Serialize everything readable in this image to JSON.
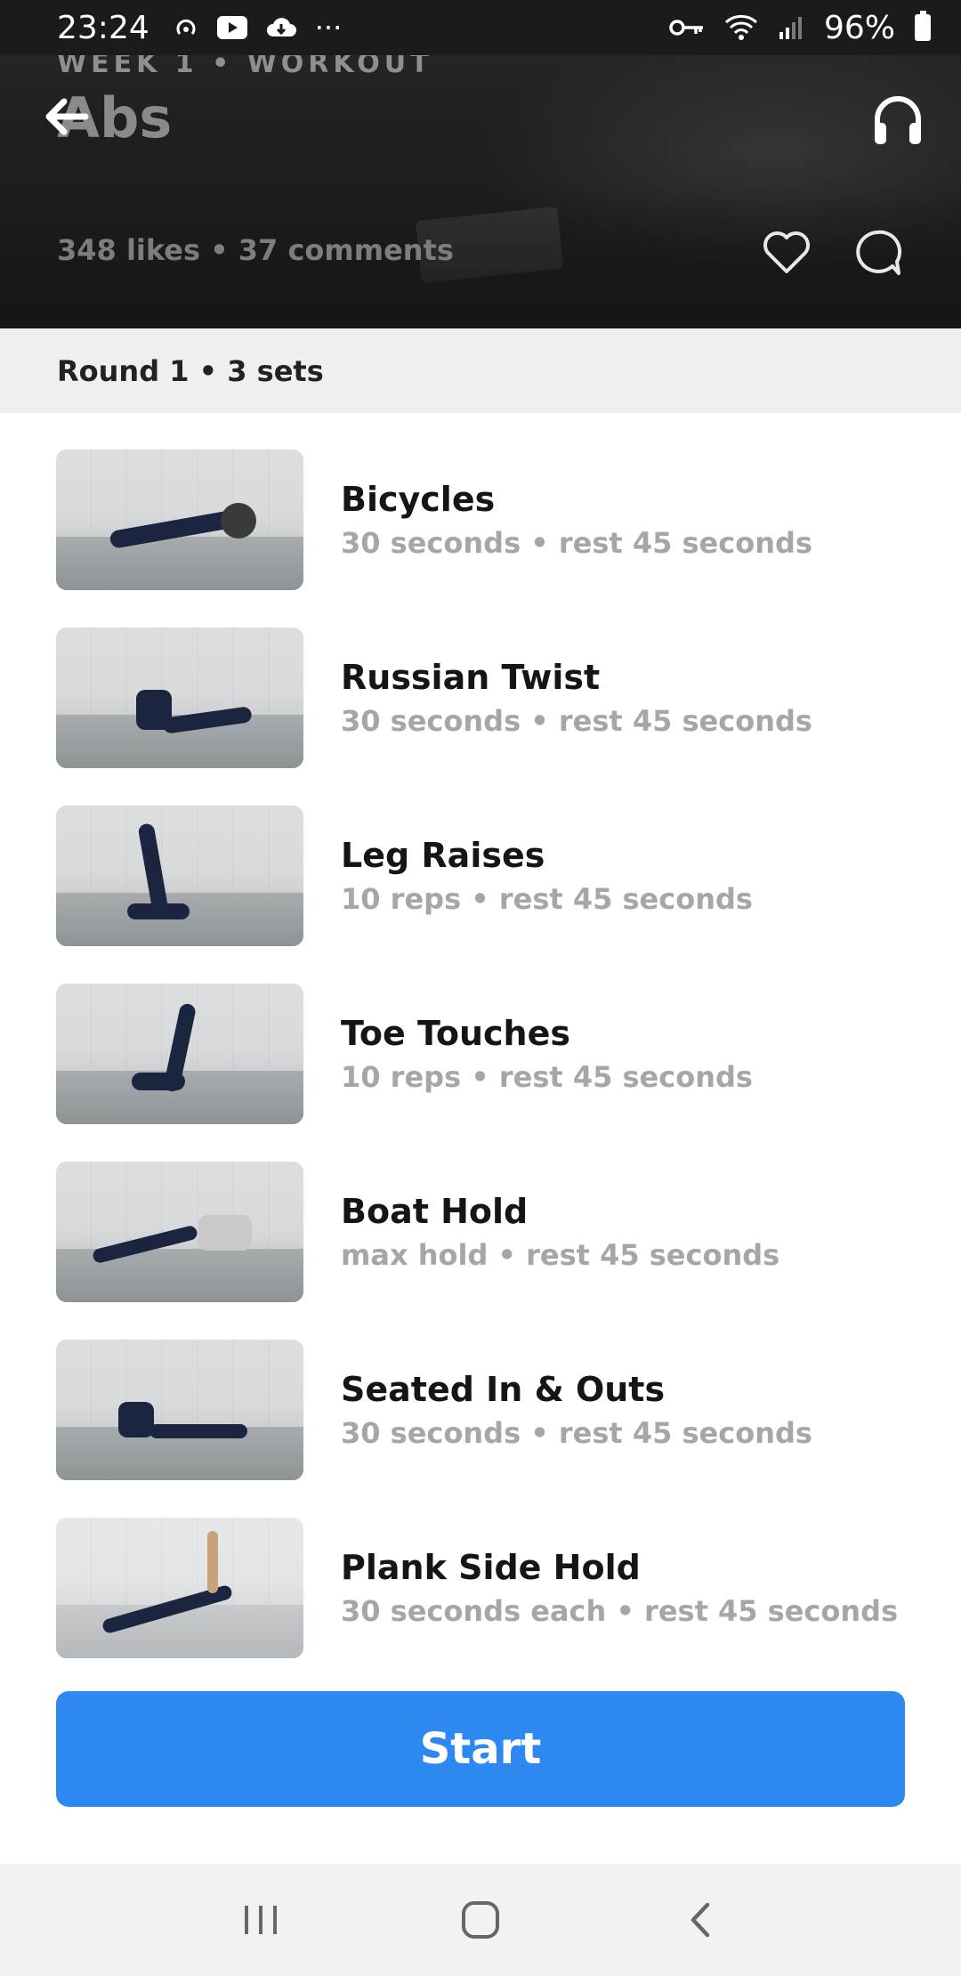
{
  "status_bar": {
    "time": "23:24",
    "battery": "96%",
    "more": "···"
  },
  "hero": {
    "eyebrow": "WEEK 1 • WORKOUT",
    "title": "Abs",
    "stats": "348 likes  •  37 comments"
  },
  "round": {
    "label": "Round 1  •  3 sets"
  },
  "exercises": [
    {
      "name": "Bicycles",
      "detail": "30 seconds • rest 45 seconds"
    },
    {
      "name": "Russian Twist",
      "detail": "30 seconds • rest 45 seconds"
    },
    {
      "name": "Leg Raises",
      "detail": "10 reps • rest 45 seconds"
    },
    {
      "name": "Toe Touches",
      "detail": "10 reps • rest 45 seconds"
    },
    {
      "name": "Boat Hold",
      "detail": "max hold • rest 45 seconds"
    },
    {
      "name": "Seated In & Outs",
      "detail": "30 seconds • rest 45 seconds"
    },
    {
      "name": "Plank Side Hold",
      "detail": "30 seconds each • rest 45 seconds"
    }
  ],
  "start_label": "Start",
  "colors": {
    "accent": "#2d88f2",
    "hero_bg": "#1f1f1f",
    "round_bg": "#efefef",
    "secondary_text": "#a6a6a6"
  },
  "icons": {
    "back": "arrow-left-icon",
    "audio": "headphones-icon",
    "like": "heart-icon",
    "comment": "comment-bubble-icon",
    "recents": "recents-icon",
    "home": "home-icon",
    "nav_back": "chevron-left-icon"
  }
}
